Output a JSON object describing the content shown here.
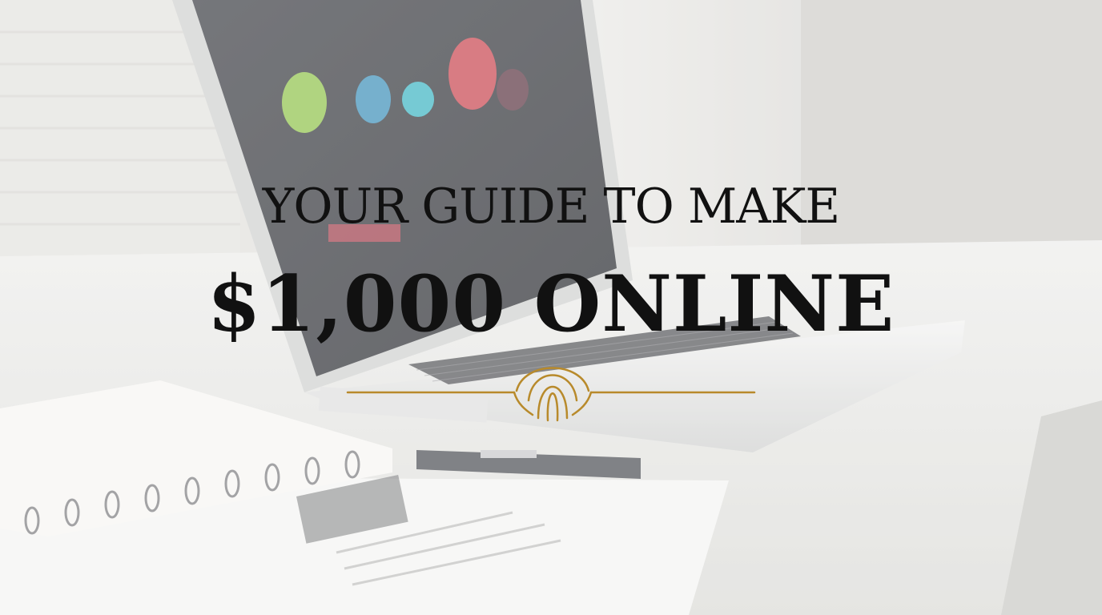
{
  "headline": {
    "line1": "YOUR GUIDE TO MAKE",
    "line2": "$1,000 ONLINE"
  },
  "colors": {
    "text": "#111111",
    "ornament_gold": "#b88a2b",
    "desk": "#e6e6e2",
    "laptop_screen": "#2b2d33"
  },
  "icons": {
    "ornament": "gold-arch-divider-icon"
  }
}
